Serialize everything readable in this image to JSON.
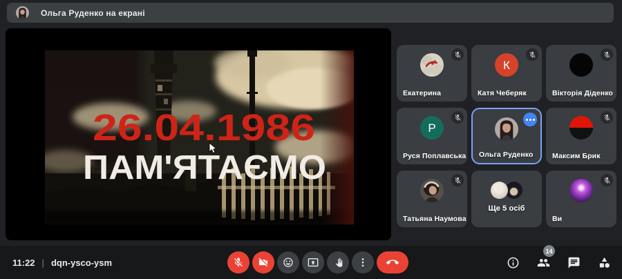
{
  "top_banner": {
    "label": "Ольга Руденко на екрані",
    "presenter_avatar": "olga-photo"
  },
  "screen_share": {
    "date_text": "26.04.1986",
    "memorial_text": "ПАМ'ЯТАЄМО",
    "date_color": "#ce2418",
    "memorial_color": "#f0ebe3",
    "description": "Chernobyl memorial video frame with power plant chimneys and clouds"
  },
  "participants": [
    {
      "name": "Екатерина",
      "muted": true,
      "avatar": "photo-red-bird"
    },
    {
      "name": "Катя Чеберяк",
      "muted": true,
      "avatar": "letter",
      "letter": "К",
      "avatar_color": "#d5432b"
    },
    {
      "name": "Вікторія Діденко",
      "muted": true,
      "avatar": "black-circle"
    },
    {
      "name": "Руся Поплавська",
      "muted": true,
      "avatar": "letter",
      "letter": "Р",
      "avatar_color": "#146c5c"
    },
    {
      "name": "Ольга Руденко",
      "muted": false,
      "active_speaker": true,
      "has_more_badge": true,
      "avatar": "photo-olga"
    },
    {
      "name": "Максим Брик",
      "muted": true,
      "avatar": "red-black-flag"
    },
    {
      "name": "Татьяна Наумова",
      "muted": true,
      "avatar": "photo-headphones"
    },
    {
      "name": "Ще 5 осіб",
      "muted": false,
      "avatar": "overflow-stack"
    },
    {
      "name": "Ви",
      "muted": true,
      "avatar": "photo-purple-stage"
    }
  ],
  "bottom_bar": {
    "time": "11:22",
    "divider": "|",
    "meeting_code": "dqn-ysco-ysm",
    "participants_badge": "14",
    "controls": [
      {
        "icon": "mic-off-icon",
        "state": "muted",
        "color": "#ea4335"
      },
      {
        "icon": "videocam-off-icon",
        "state": "off",
        "color": "#ea4335"
      },
      {
        "icon": "emoji-reactions-icon"
      },
      {
        "icon": "present-screen-icon"
      },
      {
        "icon": "raise-hand-icon"
      },
      {
        "icon": "more-options-icon"
      },
      {
        "icon": "end-call-icon",
        "color": "#ea4335"
      }
    ],
    "right_icons": [
      {
        "icon": "meeting-details-icon"
      },
      {
        "icon": "people-icon",
        "badge": "14"
      },
      {
        "icon": "chat-icon"
      },
      {
        "icon": "activities-icon"
      }
    ]
  },
  "colors": {
    "page_bg": "#202124",
    "banner_bg": "#3c4043",
    "tile_bg": "#3a3d41",
    "danger_red": "#ea4335",
    "active_border_blue": "#78a4f6",
    "badge_blue": "#4285f4"
  }
}
